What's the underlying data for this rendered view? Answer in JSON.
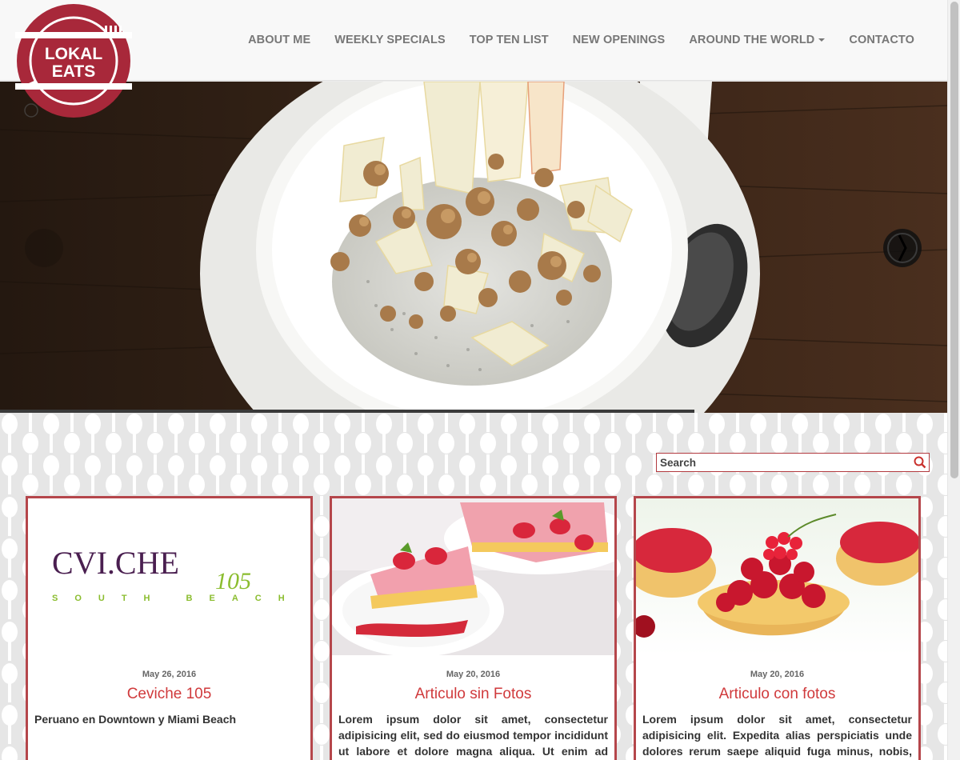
{
  "logo": {
    "line1": "LOKAL",
    "line2": "EATS"
  },
  "nav": {
    "items": [
      {
        "label": "ABOUT ME"
      },
      {
        "label": "WEEKLY SPECIALS"
      },
      {
        "label": "TOP TEN LIST"
      },
      {
        "label": "NEW OPENINGS"
      },
      {
        "label": "AROUND THE WORLD",
        "dropdown": true
      },
      {
        "label": "CONTACTO"
      }
    ]
  },
  "search": {
    "placeholder": "Search"
  },
  "cards": [
    {
      "logo_main": "CVI.CHE",
      "logo_num": "105",
      "logo_sub": "SOUTH BEACH",
      "date": "May 26, 2016",
      "title": "Ceviche 105",
      "excerpt": "Peruano en Downtown y Miami Beach"
    },
    {
      "date": "May 20, 2016",
      "title": "Articulo sin Fotos",
      "excerpt": "Lorem ipsum dolor sit amet, consectetur adipisicing elit, sed do eiusmod tempor incididunt ut labore et dolore magna aliqua. Ut enim ad minim veniam, quis nostrud exercitation"
    },
    {
      "date": "May 20, 2016",
      "title": "Articulo con fotos",
      "excerpt": "Lorem ipsum dolor sit amet, consectetur adipisicing elit. Expedita alias perspiciatis unde dolores rerum saepe aliquid fuga minus, nobis, quibusdam"
    }
  ],
  "colors": {
    "brand": "#a8283a",
    "accent": "#d03a3c",
    "card_border": "#b5464b",
    "nav_text": "#777777"
  }
}
